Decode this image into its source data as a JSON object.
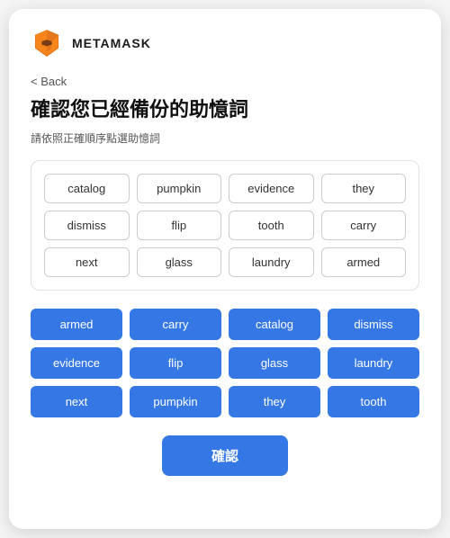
{
  "header": {
    "logo_text": "METAMASK"
  },
  "back_label": "< Back",
  "title": "確認您已經備份的助憶詞",
  "subtitle": "請依照正確順序點選助憶詞",
  "word_pool": {
    "words": [
      "catalog",
      "pumpkin",
      "evidence",
      "they",
      "dismiss",
      "flip",
      "tooth",
      "carry",
      "next",
      "glass",
      "laundry",
      "armed"
    ]
  },
  "selected_words": {
    "words": [
      "armed",
      "carry",
      "catalog",
      "dismiss",
      "evidence",
      "flip",
      "glass",
      "laundry",
      "next",
      "pumpkin",
      "they",
      "tooth"
    ]
  },
  "confirm_button_label": "確認"
}
